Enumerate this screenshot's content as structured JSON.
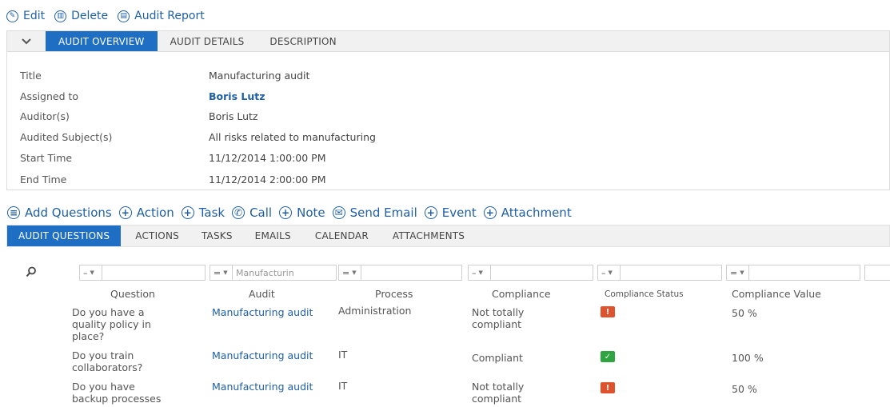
{
  "top_toolbar": {
    "edit": "Edit",
    "delete": "Delete",
    "audit_report": "Audit Report"
  },
  "overview_tabs": [
    "AUDIT OVERVIEW",
    "AUDIT DETAILS",
    "DESCRIPTION"
  ],
  "fields": [
    {
      "label": "Title",
      "value": "Manufacturing audit"
    },
    {
      "label": "Assigned to",
      "value": "Boris Lutz"
    },
    {
      "label": "Auditor(s)",
      "value": "Boris Lutz"
    },
    {
      "label": "Audited Subject(s)",
      "value": "All risks related to manufacturing"
    },
    {
      "label": "Start Time",
      "value": "11/12/2014 1:00:00 PM"
    },
    {
      "label": "End Time",
      "value": "11/12/2014 2:00:00 PM"
    }
  ],
  "actions_toolbar": {
    "add_questions": "Add Questions",
    "action": "Action",
    "task": "Task",
    "call": "Call",
    "note": "Note",
    "send_email": "Send Email",
    "event": "Event",
    "attachment": "Attachment"
  },
  "question_tabs": [
    "AUDIT QUESTIONS",
    "ACTIONS",
    "TASKS",
    "EMAILS",
    "CALENDAR",
    "ATTACHMENTS"
  ],
  "filters": [
    {
      "op": "–",
      "text": ""
    },
    {
      "op": "=",
      "text": "Manufacturin"
    },
    {
      "op": "=",
      "text": ""
    },
    {
      "op": "–",
      "text": ""
    },
    {
      "op": "–",
      "text": ""
    },
    {
      "op": "=",
      "text": ""
    }
  ],
  "columns": [
    "Question",
    "Audit",
    "Process",
    "Compliance",
    "Compliance Status",
    "Compliance Value"
  ],
  "rows": [
    {
      "question": "Do you have a quality policy in place?",
      "audit": "Manufacturing audit",
      "process": "Administration",
      "compliance": "Not totally compliant",
      "status": "warning",
      "value": "50 %"
    },
    {
      "question": "Do you train collaborators?",
      "audit": "Manufacturing audit",
      "process": "IT",
      "compliance": "Compliant",
      "status": "ok",
      "value": "100 %"
    },
    {
      "question": "Do you have backup processes",
      "audit": "Manufacturing audit",
      "process": "IT",
      "compliance": "Not totally compliant",
      "status": "warning",
      "value": "50 %"
    }
  ],
  "colors": {
    "accent": "#1e6fc3",
    "link": "#1f5fa6",
    "warning": "#e0522e",
    "ok": "#2fa541"
  }
}
